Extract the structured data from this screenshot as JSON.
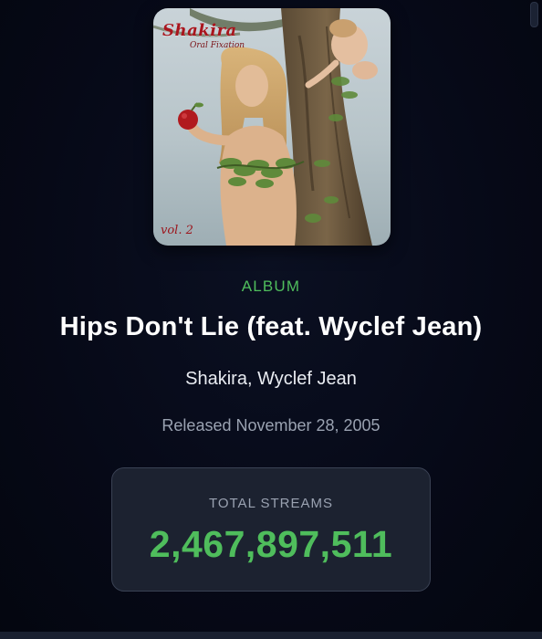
{
  "album_cover": {
    "title_text": "Shakira",
    "subtitle_text": "Oral Fixation",
    "vol_text": "vol. 2"
  },
  "release": {
    "type_label": "ALBUM",
    "title": "Hips Don't Lie (feat. Wyclef Jean)",
    "artists": "Shakira, Wyclef Jean",
    "released": "Released November 28, 2005"
  },
  "stats": {
    "streams_label": "TOTAL STREAMS",
    "streams_value": "2,467,897,511"
  },
  "colors": {
    "accent_green": "#4fbd5c",
    "background": "#060917",
    "card_background": "#1c2230",
    "muted_text": "#9aa2b1"
  }
}
